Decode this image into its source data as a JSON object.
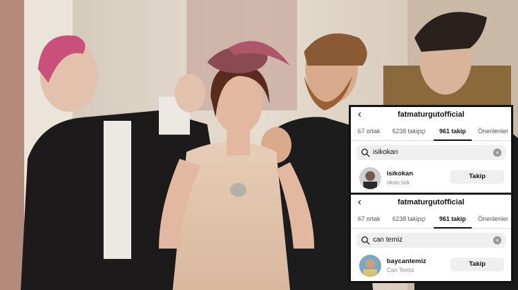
{
  "panel_top": {
    "username": "fatmaturgutofficial",
    "tabs": {
      "mutual": "67 ortak",
      "followers": "6238 takipçi",
      "following": "961 takip",
      "suggested": "Önerilenler"
    },
    "search_query": "isikokan",
    "result": {
      "handle": "isikokan",
      "name": "okan isik",
      "button": "Takip"
    }
  },
  "panel_bottom": {
    "username": "fatmaturgutofficial",
    "tabs": {
      "mutual": "67 ortak",
      "followers": "6238 takipçi",
      "following": "961 takip",
      "suggested": "Önerilenler"
    },
    "search_query": "can temiz",
    "result": {
      "handle": "baycantemiz",
      "name": "Can Temiz",
      "button": "Takip"
    }
  },
  "icons": {
    "back": "chevron-left-icon",
    "search": "search-icon",
    "clear": "clear-icon"
  }
}
